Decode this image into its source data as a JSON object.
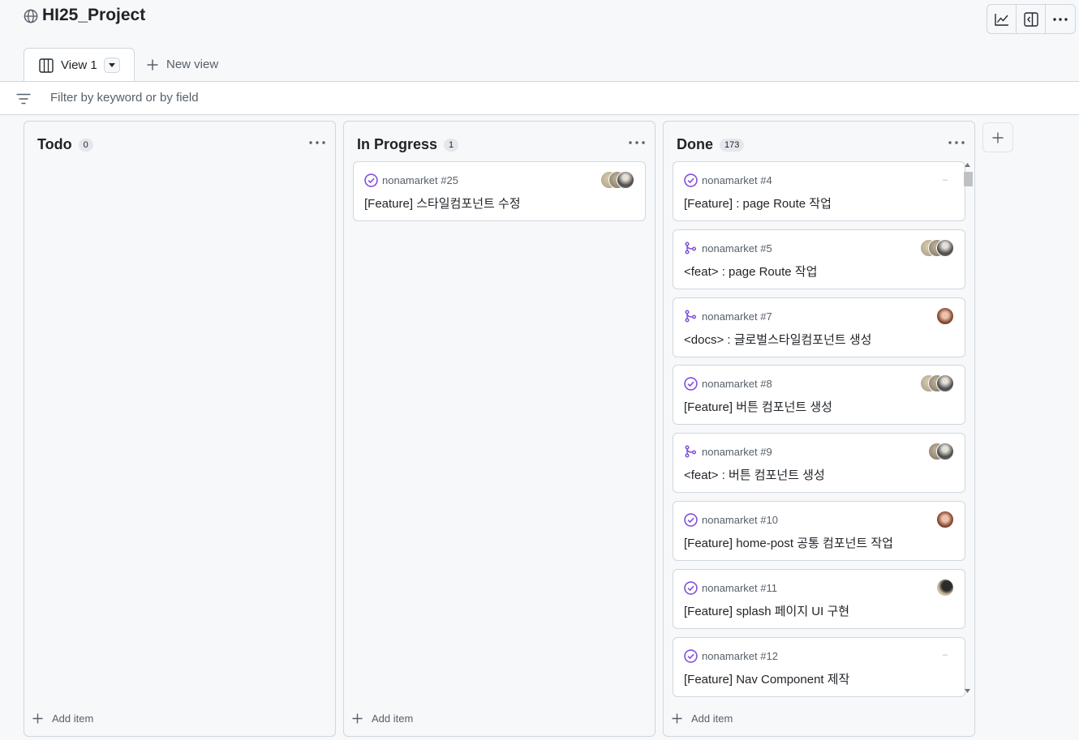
{
  "project": {
    "title": "HI25_Project",
    "icon": "globe-icon"
  },
  "header_actions": [
    {
      "name": "insights-button",
      "icon": "graph-icon"
    },
    {
      "name": "side-panel-button",
      "icon": "sidebar-icon"
    },
    {
      "name": "more-options-button",
      "icon": "kebab-horizontal-icon"
    }
  ],
  "tabs": {
    "active_label": "View 1",
    "new_view_label": "New view"
  },
  "filter": {
    "placeholder": "Filter by keyword or by field",
    "value": ""
  },
  "columns": [
    {
      "title": "Todo",
      "count": "0",
      "add_item_label": "Add item",
      "cards": []
    },
    {
      "title": "In Progress",
      "count": "1",
      "add_item_label": "Add item",
      "cards": [
        {
          "type": "issue-closed",
          "ref": "nonamarket #25",
          "title": "[Feature] 스타일컴포넌트 수정",
          "avatars": [
            "stack3"
          ]
        }
      ]
    },
    {
      "title": "Done",
      "count": "173",
      "add_item_label": "Add item",
      "cards": [
        {
          "type": "issue-closed",
          "ref": "nonamarket #4",
          "title": "[Feature] : page Route 작업",
          "avatars": [
            "blank"
          ]
        },
        {
          "type": "pull-merged",
          "ref": "nonamarket #5",
          "title": "<feat> : page Route 작업",
          "avatars": [
            "stack3"
          ]
        },
        {
          "type": "pull-merged",
          "ref": "nonamarket #7",
          "title": "<docs> : 글로벌스타일컴포넌트 생성",
          "avatars": [
            "single-brown"
          ]
        },
        {
          "type": "issue-closed",
          "ref": "nonamarket #8",
          "title": "[Feature] 버튼 컴포넌트 생성",
          "avatars": [
            "stack3"
          ]
        },
        {
          "type": "pull-merged",
          "ref": "nonamarket #9",
          "title": "<feat> : 버튼 컴포넌트 생성",
          "avatars": [
            "stack2"
          ]
        },
        {
          "type": "issue-closed",
          "ref": "nonamarket #10",
          "title": "[Feature] home-post 공통 컴포넌트 작업",
          "avatars": [
            "single-brown"
          ]
        },
        {
          "type": "issue-closed",
          "ref": "nonamarket #11",
          "title": "[Feature] splash 페이지 UI 구현",
          "avatars": [
            "single-dark"
          ]
        },
        {
          "type": "issue-closed",
          "ref": "nonamarket #12",
          "title": "[Feature] Nav Component 제작",
          "avatars": [
            "blank"
          ]
        }
      ]
    }
  ],
  "colors": {
    "accent_purple": "#8250df",
    "border": "#d0d7de",
    "muted_text": "#57606a",
    "background": "#f6f8fa"
  }
}
